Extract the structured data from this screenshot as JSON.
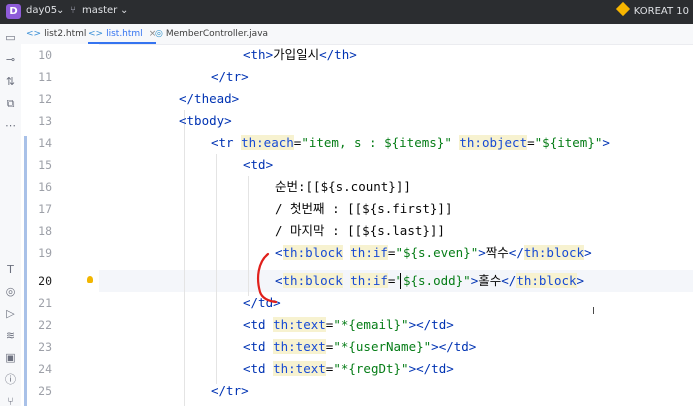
{
  "titlebar": {
    "project_badge": "D",
    "project_name": "day05",
    "branch": "master",
    "right_text": "KOREAT 10",
    "colors": {
      "badge": "#8e5bd8",
      "bg": "#2b2d30"
    }
  },
  "tabs": [
    {
      "label": "list2.html",
      "icon": "html-file-icon",
      "active": false
    },
    {
      "label": "list.html",
      "icon": "html-file-icon",
      "active": true
    },
    {
      "label": "MemberController.java",
      "icon": "java-class-icon",
      "active": false
    }
  ],
  "gutter": {
    "line_numbers": [
      "10",
      "11",
      "12",
      "13",
      "14",
      "15",
      "16",
      "17",
      "18",
      "19",
      "20",
      "21",
      "22",
      "23",
      "24",
      "25"
    ],
    "current_line": "20"
  },
  "code": {
    "l10": {
      "open": "<th>",
      "text": "가입일시",
      "close": "</th>"
    },
    "l11": {
      "close": "</tr>"
    },
    "l12": {
      "close": "</thead>"
    },
    "l13": {
      "open": "<tbody>"
    },
    "l14": {
      "open": "<tr ",
      "attr1": "th:each",
      "eq1": "=",
      "val1": "\"item, s : ${items}\"",
      "attr2": "th:object",
      "eq2": "=",
      "val2": "\"${item}\"",
      "end": ">"
    },
    "l15": {
      "open": "<td>"
    },
    "l16": {
      "text": "순번:[[${s.count}]]"
    },
    "l17": {
      "text": "/ 첫번째 : [[${s.first}]]"
    },
    "l18": {
      "text": "/ 마지막 : [[${s.last}]]"
    },
    "l19": {
      "open": "<",
      "tagname": "th:block",
      "sp": " ",
      "attr": "th:if",
      "eq": "=",
      "val": "\"${s.even}\"",
      "gt": ">",
      "text": "짝수",
      "close1": "</",
      "close_tag": "th:block",
      "close2": ">"
    },
    "l20": {
      "open": "<",
      "tagname": "th:block",
      "sp": " ",
      "attr": "th:if",
      "eq": "=",
      "val": "\"${s.odd}\"",
      "gt": ">",
      "text": "홀수",
      "close1": "</",
      "close_tag": "th:block",
      "close2": ">"
    },
    "l21": {
      "close": "</td>"
    },
    "l22": {
      "open": "<td ",
      "attr": "th:text",
      "eq": "=",
      "val": "\"*{email}\"",
      "end": "></td>"
    },
    "l23": {
      "open": "<td ",
      "attr": "th:text",
      "eq": "=",
      "val": "\"*{userName}\"",
      "end": "></td>"
    },
    "l24": {
      "open": "<td ",
      "attr": "th:text",
      "eq": "=",
      "val": "\"*{regDt}\"",
      "end": "></td>"
    },
    "l25": {
      "close": "</tr>"
    }
  },
  "colors": {
    "tag": "#0033b3",
    "attr": "#174ad4",
    "string": "#067d17",
    "attr_highlight": "#f7f2d0",
    "annotation": "#e0201b"
  }
}
